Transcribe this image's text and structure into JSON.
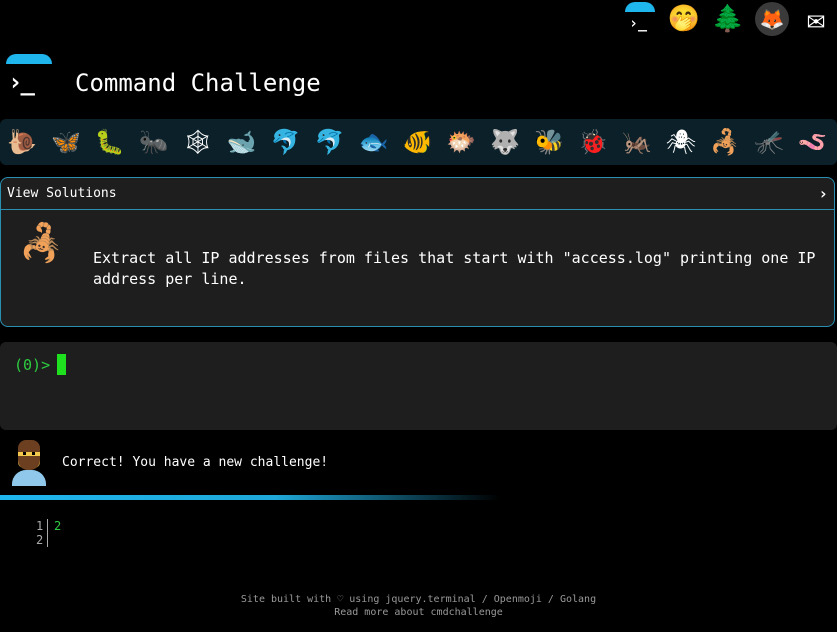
{
  "top_icons": {
    "terminal": "›_",
    "face": "🤭",
    "tree": "🌲",
    "gitlab": "🦊",
    "mail": "✉"
  },
  "header": {
    "logo_glyph": "›_",
    "title": "Command Challenge"
  },
  "animals": [
    "🐌",
    "🦋",
    "🐛",
    "🐜",
    "🕸",
    "🐋",
    "🐬",
    "🐬",
    "🐟",
    "🐠",
    "🐡",
    "🐺",
    "🐝",
    "🐞",
    "🦗",
    "🕷",
    "🦂",
    "🦟",
    "🪱"
  ],
  "challenge": {
    "solutions_label": "View Solutions",
    "chevron": "›",
    "icon": "🦂",
    "text": "Extract all IP addresses from files that start with \"access.log\" printing one IP address per line."
  },
  "terminal": {
    "prompt": "(0)>"
  },
  "feedback": {
    "message": "Correct! You have a new challenge!"
  },
  "output": {
    "line_numbers": [
      "1",
      "2"
    ],
    "values": [
      "2",
      ""
    ]
  },
  "footer": {
    "line1": "Site built with ♡ using jquery.terminal / Openmoji / Golang",
    "line2": "Read more about cmdchallenge"
  },
  "colors": {
    "accent": "#1fb6ee",
    "prompt_green": "#2ecc40",
    "panel_bg": "#1e1e1e",
    "panel_border": "#2a8fb0"
  }
}
